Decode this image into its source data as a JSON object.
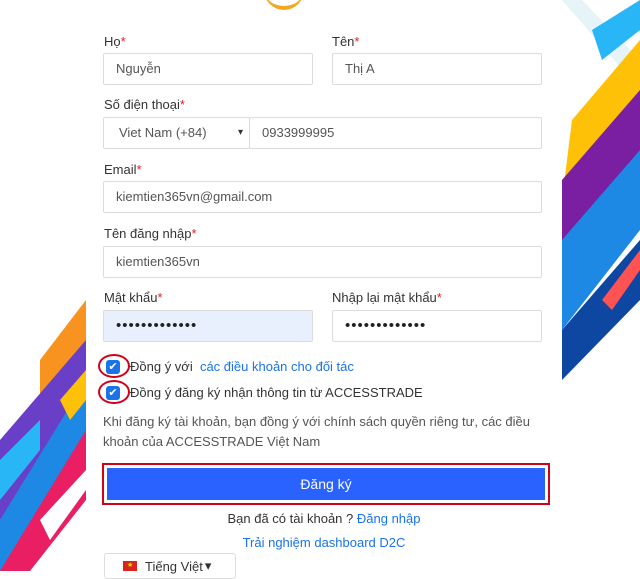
{
  "form": {
    "last_name": {
      "label": "Họ",
      "req": "*",
      "value": "Nguyễn"
    },
    "first_name": {
      "label": "Tên",
      "req": "*",
      "value": "Thị A"
    },
    "phone": {
      "label": "Số điện thoại",
      "req": "*",
      "country": "Viet Nam (+84)",
      "value": "0933999995"
    },
    "email": {
      "label": "Email",
      "req": "*",
      "value": "kiemtien365vn@gmail.com"
    },
    "username": {
      "label": "Tên đăng nhập",
      "req": "*",
      "value": "kiemtien365vn"
    },
    "password": {
      "label": "Mật khẩu",
      "req": "*",
      "value": "•••••••••••••"
    },
    "password_confirm": {
      "label": "Nhập lại mật khẩu",
      "req": "*",
      "value": "•••••••••••••"
    }
  },
  "agreements": {
    "terms_prefix": "Đồng ý với",
    "terms_link": "các điều khoản cho đối tác",
    "newsletter": "Đồng ý đăng ký nhận thông tin từ ACCESSTRADE",
    "check_glyph": "✔"
  },
  "privacy_note": "Khi đăng ký tài khoản, bạn đồng ý với chính sách quyền riêng tư, các điều khoản của ACCESSTRADE Việt Nam",
  "submit_label": "Đăng ký",
  "login_prompt": "Bạn đã có tài khoản ?",
  "login_link": "Đăng nhập",
  "d2c_link": "Trải nghiệm dashboard D2C",
  "language": {
    "label": "Tiếng Việt",
    "arrow": "▾"
  },
  "select_arrow": "▾",
  "colors": {
    "primary": "#2962ff",
    "link": "#1a73e8",
    "required": "#e02020",
    "highlight": "#d0021b",
    "autofill": "#e8f0fe"
  }
}
